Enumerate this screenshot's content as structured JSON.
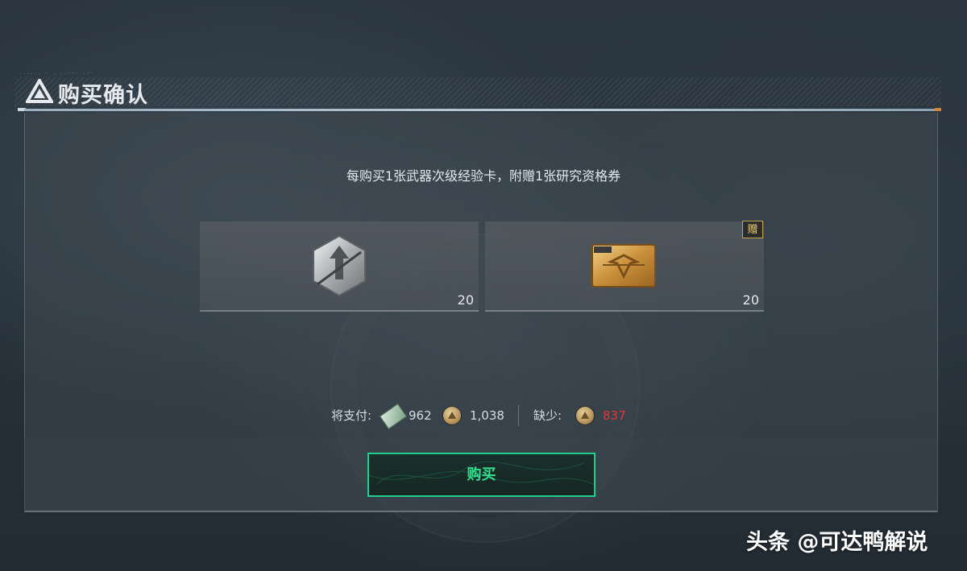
{
  "header": {
    "title": "购买确认",
    "small_text": "...... - . ..--- .--"
  },
  "description": "每购买1张武器次级经验卡，附赠1张研究资格券",
  "items": [
    {
      "name_icon": "weapon-exp-card-icon",
      "quantity": "20"
    },
    {
      "name_icon": "research-ticket-icon",
      "quantity": "20",
      "badge": "赠"
    }
  ],
  "payment": {
    "label": "将支付:",
    "currency1_icon": "bill-icon",
    "currency1_amount": "962",
    "currency2_icon": "coin-icon",
    "currency2_amount": "1,038",
    "shortage_label": "缺少:",
    "shortage_icon": "coin-icon",
    "shortage_amount": "837"
  },
  "buy_button": "购买",
  "watermark": "头条 @可达鸭解说",
  "colors": {
    "accent_green": "#1ed08c",
    "shortage_red": "#e2353a",
    "gift_gold": "#c5a44a"
  }
}
